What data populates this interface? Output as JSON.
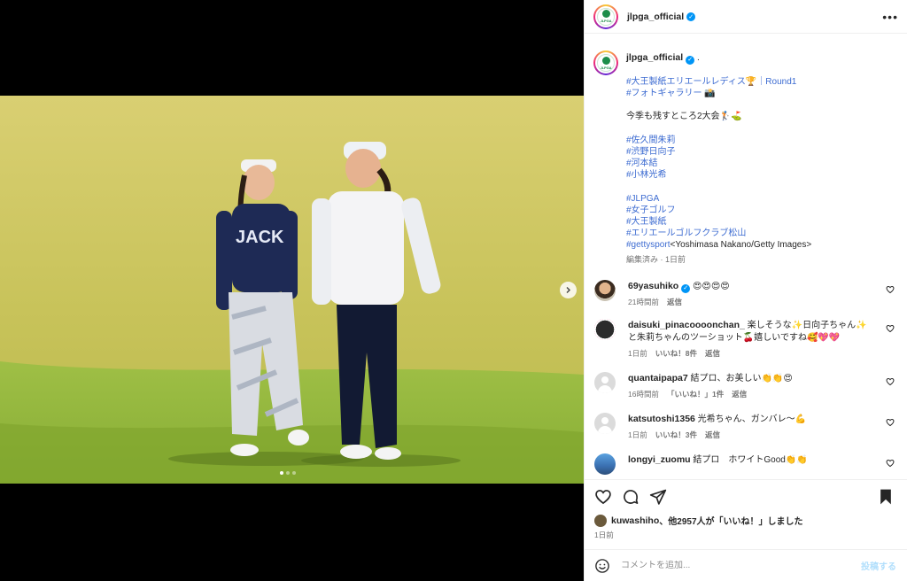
{
  "post": {
    "username": "jlpga_official",
    "avatar_logo_text": "JLPGA"
  },
  "caption": {
    "username": "jlpga_official",
    "first": ".",
    "lines": [
      {
        "text": "#大王製紙エリエールレディス🏆｜Round1",
        "tag": true
      },
      {
        "text": "#フォトギャラリー 📸",
        "tag": true
      },
      {
        "text": "",
        "tag": false
      },
      {
        "text": "今季も残すところ2大会🏌️⛳",
        "tag": false
      },
      {
        "text": "",
        "tag": false
      },
      {
        "text": "#佐久間朱莉",
        "tag": true
      },
      {
        "text": "#渋野日向子",
        "tag": true
      },
      {
        "text": "#河本結",
        "tag": true
      },
      {
        "text": "#小林光希",
        "tag": true
      },
      {
        "text": "",
        "tag": false
      },
      {
        "text": "#JLPGA",
        "tag": true
      },
      {
        "text": "#女子ゴルフ",
        "tag": true
      },
      {
        "text": "#大王製紙",
        "tag": true
      },
      {
        "text": "#エリエールゴルフクラブ松山",
        "tag": true
      }
    ],
    "getty_tag": "#gettysport",
    "getty_credit": "<Yoshimasa Nakano/Getty Images>",
    "edited": "編集済み",
    "edited_time": "1日前"
  },
  "comments": [
    {
      "user": "69yasuhiko",
      "verified": true,
      "text": "😍😍😍😍",
      "time": "21時間前",
      "likes": "",
      "reply": "返信",
      "avatar": "photo-man"
    },
    {
      "user": "daisuki_pinacoooonchan_",
      "verified": false,
      "text": "楽しそうな✨日向子ちゃん✨と朱莉ちゃんのツーショット🍒嬉しいですね🥰💖💖",
      "time": "1日前",
      "likes": "いいね！8件",
      "reply": "返信",
      "avatar": "photo-dark"
    },
    {
      "user": "quantaipapa7",
      "verified": false,
      "text": "結プロ、お美しい👏👏😍",
      "time": "16時間前",
      "likes": "「いいね！」1件",
      "reply": "返信",
      "avatar": "default"
    },
    {
      "user": "katsutoshi1356",
      "verified": false,
      "text": "光希ちゃん、ガンバレ〜💪",
      "time": "1日前",
      "likes": "いいね！3件",
      "reply": "返信",
      "avatar": "default"
    },
    {
      "user": "longyi_zuomu",
      "verified": false,
      "text": "結プロ　ホワイトGood👏👏",
      "time": "",
      "likes": "",
      "reply": "",
      "avatar": "photo-sky"
    }
  ],
  "likes": {
    "user": "kuwashiho",
    "text": "、他2957人が「いいね！」しました"
  },
  "date": "1日前",
  "add_comment": {
    "placeholder": "コメントを追加...",
    "post_label": "投稿する"
  },
  "carousel": {
    "count": 3,
    "current": 1
  },
  "colors": {
    "link": "#3c6bd1",
    "verified": "#0095f6",
    "post_disabled": "#b2dffc",
    "fairway": "#c9c45a"
  }
}
